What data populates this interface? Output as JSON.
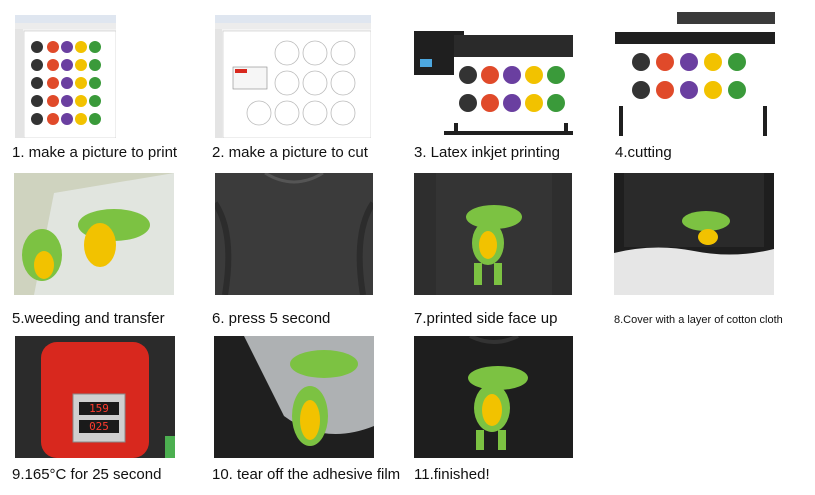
{
  "steps": [
    {
      "label": "1. make a picture to print"
    },
    {
      "label": "2. make a picture to cut"
    },
    {
      "label": "3. Latex inkjet printing"
    },
    {
      "label": "4.cutting"
    },
    {
      "label": "5.weeding and transfer"
    },
    {
      "label": "6. press 5 second"
    },
    {
      "label": "7.printed side face up"
    },
    {
      "label": "8.Cover with a layer of cotton cloth"
    },
    {
      "label": "9.165°C for 25 second"
    },
    {
      "label": "10. tear off the adhesive film"
    },
    {
      "label": "11.finished!"
    }
  ],
  "heat_press_display": {
    "top": "159",
    "bottom": "025"
  },
  "colors": {
    "shirt": "#2b2b2b",
    "gator_green": "#7cc242",
    "gator_belly": "#f2c200",
    "press_red": "#d8281e",
    "printer_black": "#1f1f1f"
  }
}
